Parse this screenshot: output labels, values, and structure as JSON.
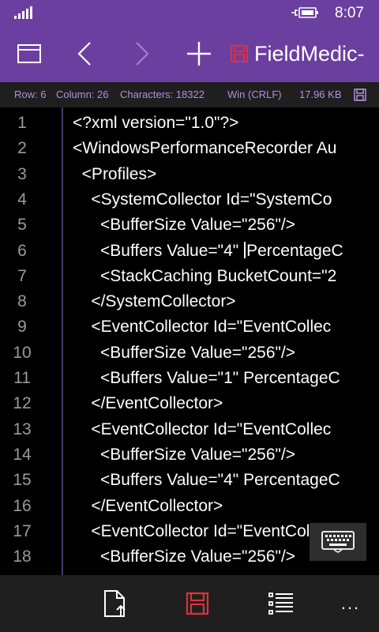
{
  "status": {
    "time": "8:07",
    "signal_icon": "signal-bars-icon",
    "battery_icon": "battery-charging-icon"
  },
  "toolbar": {
    "window_icon": "window-icon",
    "back_icon": "chevron-left-icon",
    "forward_icon": "chevron-right-icon",
    "add_icon": "plus-icon",
    "tab_title": "FieldMedic-",
    "tab_icon": "save-icon-unsaved"
  },
  "info": {
    "row": "Row: 6",
    "column": "Column: 26",
    "characters": "Characters: 18322",
    "line_ending": "Win (CRLF)",
    "size": "17.96 KB"
  },
  "editor": {
    "lines": [
      {
        "n": "1",
        "text": "<?xml version=\"1.0\"?>"
      },
      {
        "n": "2",
        "text": "<WindowsPerformanceRecorder Au"
      },
      {
        "n": "3",
        "text": "  <Profiles>"
      },
      {
        "n": "4",
        "text": "    <SystemCollector Id=\"SystemCo"
      },
      {
        "n": "5",
        "text": "      <BufferSize Value=\"256\"/>"
      },
      {
        "n": "6",
        "text": "      <Buffers Value=\"4\" PercentageC"
      },
      {
        "n": "7",
        "text": "      <StackCaching BucketCount=\"2"
      },
      {
        "n": "8",
        "text": "    </SystemCollector>"
      },
      {
        "n": "9",
        "text": "    <EventCollector Id=\"EventCollec"
      },
      {
        "n": "10",
        "text": "      <BufferSize Value=\"256\"/>"
      },
      {
        "n": "11",
        "text": "      <Buffers Value=\"1\" PercentageC"
      },
      {
        "n": "12",
        "text": "    </EventCollector>"
      },
      {
        "n": "13",
        "text": "    <EventCollector Id=\"EventCollec"
      },
      {
        "n": "14",
        "text": "      <BufferSize Value=\"256\"/>"
      },
      {
        "n": "15",
        "text": "      <Buffers Value=\"4\" PercentageC"
      },
      {
        "n": "16",
        "text": "    </EventCollector>"
      },
      {
        "n": "17",
        "text": "    <EventCollector Id=\"EventCollec"
      },
      {
        "n": "18",
        "text": "      <BufferSize Value=\"256\"/>"
      }
    ],
    "caret_line": "6",
    "keyboard_icon": "keyboard-icon"
  },
  "appbar": {
    "open_icon": "open-file-icon",
    "save_icon": "save-icon",
    "list_icon": "list-icon",
    "more_label": "..."
  },
  "colors": {
    "accent": "#6b3fa0",
    "info_text": "#b090e0",
    "save_red": "#e0303a"
  }
}
